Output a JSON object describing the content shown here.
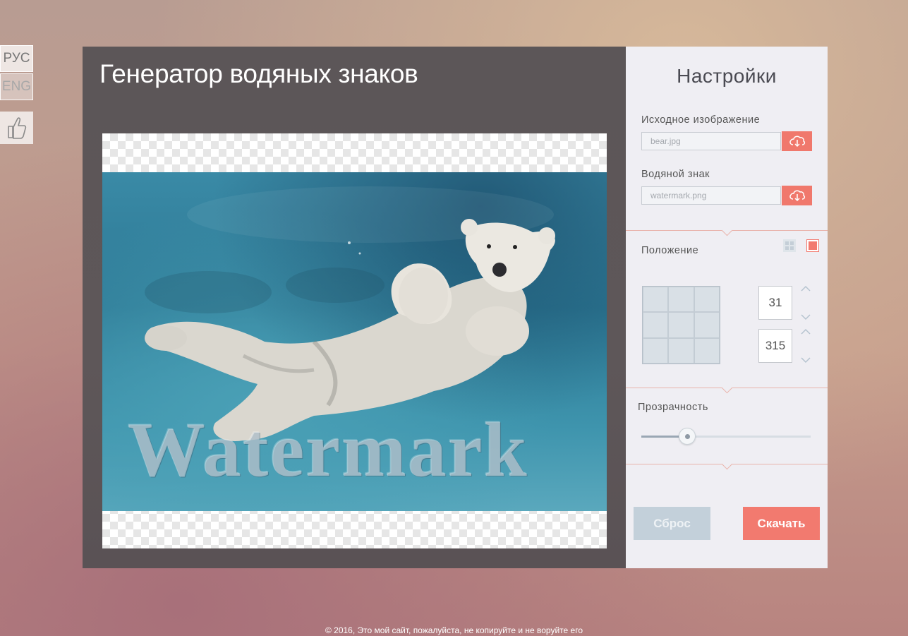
{
  "lang": {
    "ru": "РУС",
    "en": "ENG"
  },
  "app": {
    "title": "Генератор водяных знаков"
  },
  "preview": {
    "watermark_text": "Watermark"
  },
  "settings": {
    "title": "Настройки",
    "source_label": "Исходное изображение",
    "source_file": "bear.jpg",
    "watermark_label": "Водяной знак",
    "watermark_file": "watermark.png",
    "position_label": "Положение",
    "coord_x": "31",
    "coord_y": "315",
    "opacity_label": "Прозрачность",
    "opacity_value": 0.27,
    "reset_label": "Сброс",
    "download_label": "Скачать"
  },
  "colors": {
    "accent": "#f27a6f",
    "reset": "#c3d0da",
    "panel": "#5e5759",
    "settings_bg": "#efeef3"
  },
  "icons": {
    "like": "thumbs-up-icon",
    "upload": "cloud-upload-icon",
    "mode_tile": "grid-tile-icon",
    "mode_single": "single-tile-icon"
  },
  "footer": "© 2016, Это мой сайт, пожалуйста, не копируйте и не воруйте его"
}
